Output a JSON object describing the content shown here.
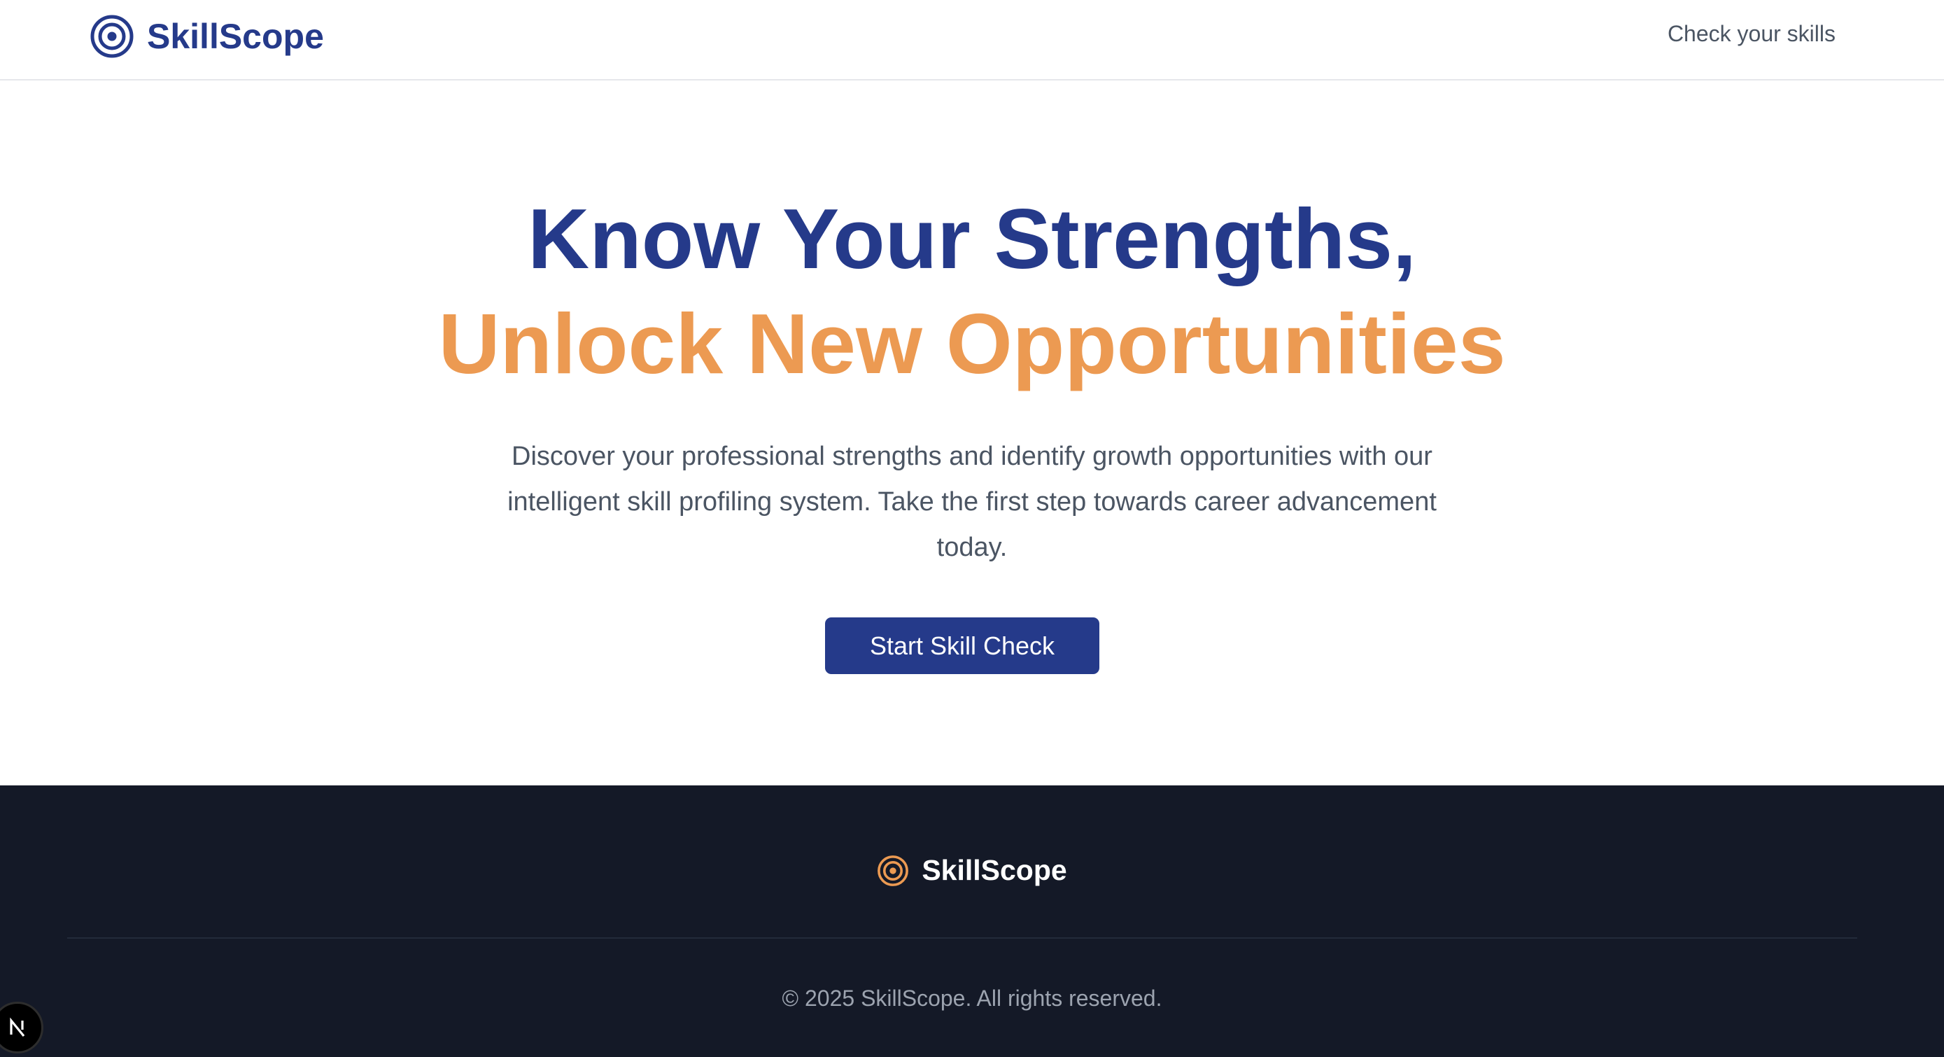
{
  "header": {
    "brand_name": "SkillScope",
    "nav_link": "Check your skills"
  },
  "hero": {
    "title_line1": "Know Your Strengths,",
    "title_line2": "Unlock New Opportunities",
    "description": "Discover your professional strengths and identify growth opportunities with our intelligent skill profiling system. Take the first step towards career advancement today.",
    "cta_label": "Start Skill Check"
  },
  "footer": {
    "brand_name": "SkillScope",
    "copyright": "© 2025 SkillScope. All rights reserved."
  },
  "dev_badge": {
    "label": "N"
  },
  "colors": {
    "primary": "#253a8a",
    "accent": "#ec9a52",
    "text_muted": "#4b5563",
    "footer_bg": "#141927",
    "footer_text": "#9ca3af"
  },
  "icons": {
    "brand": "target-icon",
    "footer_brand": "target-icon"
  }
}
